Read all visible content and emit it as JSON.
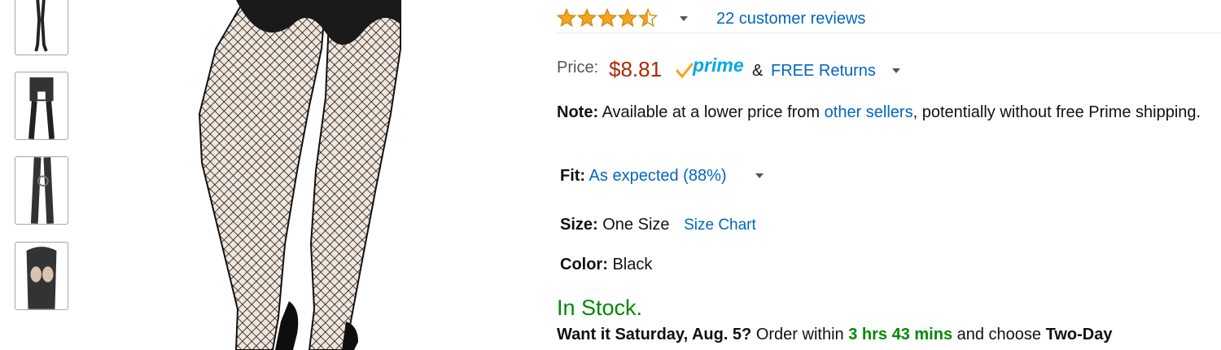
{
  "colors": {
    "link": "#0066c0",
    "price": "#b12704",
    "stock": "#008a00",
    "star": "#f4a41c",
    "prime": "#00a8e1"
  },
  "thumbnails": [
    {
      "icon": "legs-standing-thumbnail"
    },
    {
      "icon": "bodysuit-front-thumbnail"
    },
    {
      "icon": "legs-side-thumbnail"
    },
    {
      "icon": "back-view-thumbnail"
    }
  ],
  "product_image": {
    "icon": "fishnet-tights-legs-image"
  },
  "rating": {
    "stars": 4.5,
    "max": 5,
    "reviews_text": "22 customer reviews"
  },
  "price": {
    "label": "Price:",
    "value": "$8.81",
    "prime_text": "prime",
    "amp": "&",
    "returns_text": "FREE Returns"
  },
  "note": {
    "label": "Note:",
    "text_before": " Available at a lower price from ",
    "link_text": "other sellers",
    "text_after": ", potentially without free Prime shipping."
  },
  "fit": {
    "label": "Fit:",
    "value": "As expected (88%)"
  },
  "size": {
    "label": "Size:",
    "value": "One Size",
    "chart_link": "Size Chart"
  },
  "color": {
    "label": "Color:",
    "value": "Black"
  },
  "stock": {
    "status": "In Stock."
  },
  "delivery": {
    "question": "Want it Saturday, Aug. 5?",
    "order_within": " Order within ",
    "countdown": "3 hrs 43 mins",
    "and_choose": " and choose ",
    "shipping_option": "Two-Day"
  }
}
